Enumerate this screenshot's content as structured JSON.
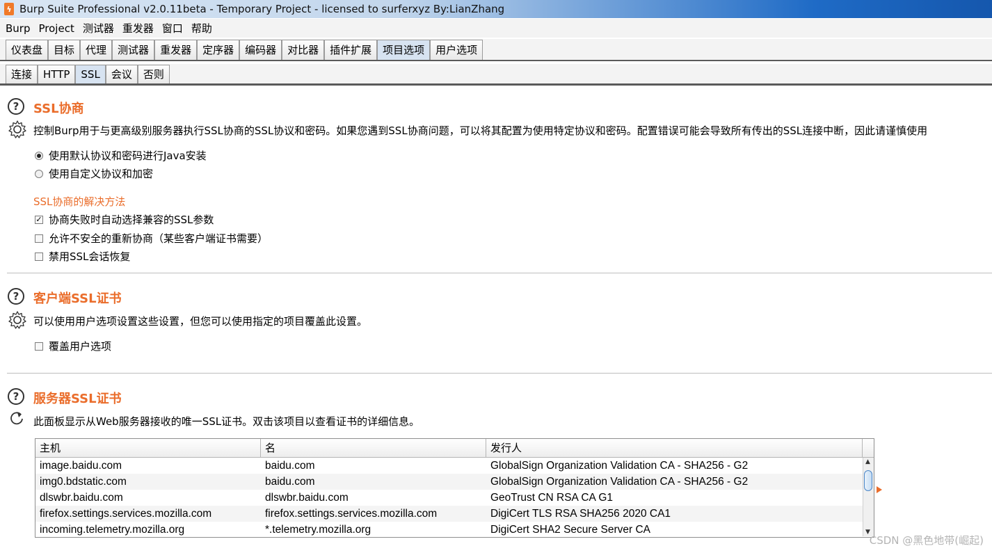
{
  "window": {
    "title": "Burp Suite Professional v2.0.11beta - Temporary Project - licensed to surferxyz By:LianZhang",
    "icon": "burp-logo-icon"
  },
  "menubar": [
    "Burp",
    "Project",
    "测试器",
    "重发器",
    "窗口",
    "帮助"
  ],
  "main_tabs": [
    {
      "label": "仪表盘",
      "active": false
    },
    {
      "label": "目标",
      "active": false
    },
    {
      "label": "代理",
      "active": false
    },
    {
      "label": "测试器",
      "active": false
    },
    {
      "label": "重发器",
      "active": false
    },
    {
      "label": "定序器",
      "active": false
    },
    {
      "label": "编码器",
      "active": false
    },
    {
      "label": "对比器",
      "active": false
    },
    {
      "label": "插件扩展",
      "active": false
    },
    {
      "label": "项目选项",
      "active": true
    },
    {
      "label": "用户选项",
      "active": false
    }
  ],
  "sub_tabs": [
    {
      "label": "连接",
      "active": false
    },
    {
      "label": "HTTP",
      "active": false
    },
    {
      "label": "SSL",
      "active": true
    },
    {
      "label": "会议",
      "active": false
    },
    {
      "label": "否则",
      "active": false
    }
  ],
  "ssl_negotiation": {
    "title": "SSL协商",
    "description": "控制Burp用于与更高级别服务器执行SSL协商的SSL协议和密码。如果您遇到SSL协商问题，可以将其配置为使用特定协议和密码。配置错误可能会导致所有传出的SSL连接中断，因此请谨慎使用",
    "radio_default": "使用默认协议和密码进行Java安装",
    "radio_custom": "使用自定义协议和加密",
    "workarounds_title": "SSL协商的解决方法",
    "opt_auto_select": "协商失败时自动选择兼容的SSL参数",
    "opt_allow_unsafe": "允许不安全的重新协商（某些客户端证书需要）",
    "opt_disable_resume": "禁用SSL会话恢复"
  },
  "client_ssl": {
    "title": "客户端SSL证书",
    "description": "可以使用用户选项设置这些设置，但您可以使用指定的项目覆盖此设置。",
    "opt_override": "覆盖用户选项"
  },
  "server_ssl": {
    "title": "服务器SSL证书",
    "description": "此面板显示从Web服务器接收的唯一SSL证书。双击该项目以查看证书的详细信息。",
    "columns": {
      "host": "主机",
      "name": "名",
      "issuer": "发行人"
    },
    "rows": [
      {
        "host": "image.baidu.com",
        "name": "baidu.com",
        "issuer": "GlobalSign Organization Validation CA - SHA256 - G2"
      },
      {
        "host": "img0.bdstatic.com",
        "name": "baidu.com",
        "issuer": "GlobalSign Organization Validation CA - SHA256 - G2"
      },
      {
        "host": "dlswbr.baidu.com",
        "name": "dlswbr.baidu.com",
        "issuer": "GeoTrust CN RSA CA G1"
      },
      {
        "host": "firefox.settings.services.mozilla.com",
        "name": "firefox.settings.services.mozilla.com",
        "issuer": "DigiCert TLS RSA SHA256 2020 CA1"
      },
      {
        "host": "incoming.telemetry.mozilla.org",
        "name": "*.telemetry.mozilla.org",
        "issuer": "DigiCert SHA2 Secure Server CA"
      }
    ]
  },
  "watermark": "CSDN @黑色地带(崛起)",
  "colors": {
    "accent": "#ea6d2b",
    "active_tab": "#d7e3f1"
  }
}
